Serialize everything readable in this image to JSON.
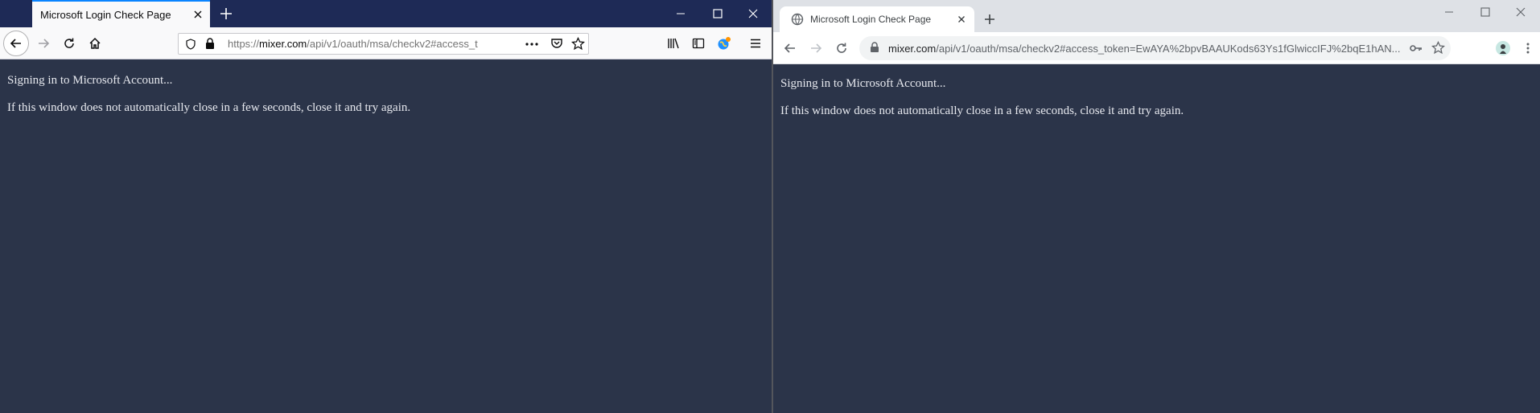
{
  "firefox": {
    "tab_title": "Microsoft Login Check Page",
    "url": {
      "scheme": "https://",
      "host": "mixer.com",
      "path": "/api/v1/oauth/msa/checkv2#access_t"
    },
    "page": {
      "line1": "Signing in to Microsoft Account...",
      "line2": "If this window does not automatically close in a few seconds, close it and try again."
    },
    "colors": {
      "tabbar": "#1e2a56",
      "accent": "#0a84ff",
      "page_bg": "#2b3449"
    }
  },
  "chrome": {
    "tab_title": "Microsoft Login Check Page",
    "url": {
      "host": "mixer.com",
      "path": "/api/v1/oauth/msa/checkv2#access_token=EwAYA%2bpvBAAUKods63Ys1fGlwiccIFJ%2bqE1hAN..."
    },
    "page": {
      "line1": "Signing in to Microsoft Account...",
      "line2": "If this window does not automatically close in a few seconds, close it and try again."
    },
    "colors": {
      "tabbar": "#dee1e6",
      "page_bg": "#2b3449"
    }
  }
}
